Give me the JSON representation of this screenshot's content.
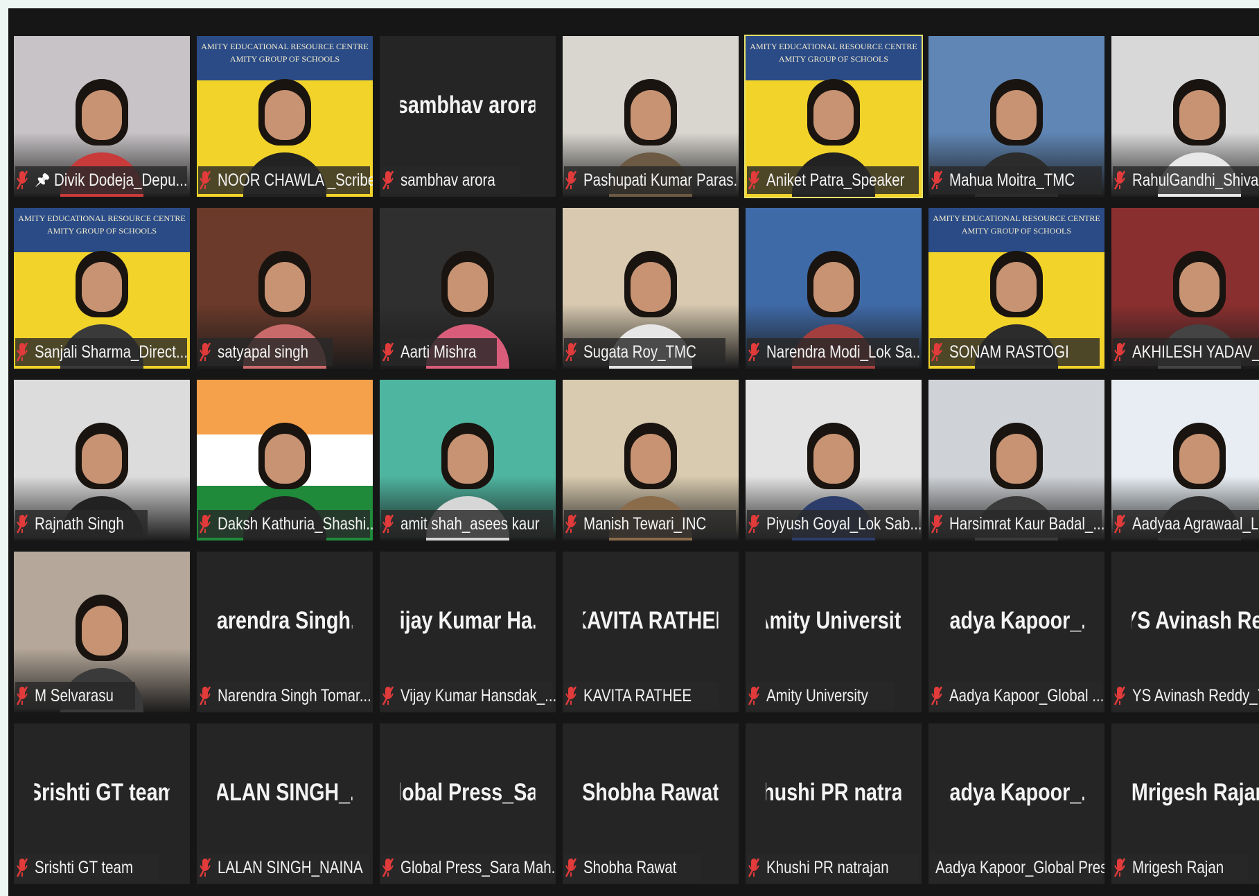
{
  "meeting": {
    "active_speaker": "Aniket Patra_Speaker",
    "colors": {
      "background": "#161616",
      "tile": "#252525",
      "active_border": "#e6e06a",
      "muted_icon": "#e23b3b"
    },
    "banner_text": "AMITY EDUCATIONAL RESOURCE CENTRE",
    "banner_sub": "AMITY GROUP OF SCHOOLS"
  },
  "rows": [
    [
      {
        "label": "Divik Dodeja_Depu...",
        "type": "video",
        "bg": "#c7c3c6",
        "shirt": "#c93a3a",
        "pinned": true
      },
      {
        "label": "NOOR CHAWLA _Scribe",
        "type": "banner",
        "shirt": "#222222"
      },
      {
        "label": "sambhav arora",
        "type": "name",
        "display": "sambhav arora"
      },
      {
        "label": "Pashupati Kumar Paras...",
        "type": "video",
        "bg": "#d9d6cf",
        "shirt": "#6c5a44"
      },
      {
        "label": "Aniket Patra_Speaker",
        "type": "banner",
        "shirt": "#222222",
        "active": true
      },
      {
        "label": "Mahua Moitra_TMC",
        "type": "video",
        "bg": "#5f86b5",
        "shirt": "#2c2c2c"
      },
      {
        "label": "RahulGandhi_Shivar",
        "type": "video",
        "bg": "#d8d8d8",
        "shirt": "#e8e8e8"
      }
    ],
    [
      {
        "label": "Sanjali Sharma_Direct...",
        "type": "banner",
        "shirt": "#3a3a3a"
      },
      {
        "label": "satyapal singh",
        "type": "video",
        "bg": "#6b3a2a",
        "shirt": "#c86a6a"
      },
      {
        "label": "Aarti Mishra",
        "type": "video",
        "bg": "#2f2f2f",
        "shirt": "#d95d7a"
      },
      {
        "label": "Sugata Roy_TMC",
        "type": "video",
        "bg": "#d8c9b0",
        "shirt": "#e6e6e6"
      },
      {
        "label": "Narendra Modi_Lok Sa...",
        "type": "video",
        "bg": "#3f6aa8",
        "shirt": "#a33f3f"
      },
      {
        "label": "SONAM RASTOGI",
        "type": "banner",
        "shirt": "#2c2c2c"
      },
      {
        "label": "AKHILESH YADAV_S",
        "type": "video",
        "bg": "#8a2f2f",
        "shirt": "#444444"
      }
    ],
    [
      {
        "label": "Rajnath Singh",
        "type": "video",
        "bg": "#dcdcdc",
        "shirt": "#222222"
      },
      {
        "label": "Daksh Kathuria_Shashi...",
        "type": "flag",
        "shirt": "#222222"
      },
      {
        "label": "amit shah_asees kaur",
        "type": "video",
        "bg": "#4eb5a0",
        "shirt": "#d6d6d6"
      },
      {
        "label": "Manish Tewari_INC",
        "type": "video",
        "bg": "#d9cbb0",
        "shirt": "#8a6b4a"
      },
      {
        "label": "Piyush Goyal_Lok Sab...",
        "type": "video",
        "bg": "#e3e3e3",
        "shirt": "#2c3d6b"
      },
      {
        "label": "Harsimrat Kaur Badal_...",
        "type": "video",
        "bg": "#cfd2d6",
        "shirt": "#3a3a3a"
      },
      {
        "label": "Aadyaa Agrawaal_Lo",
        "type": "video",
        "bg": "#e7edf2",
        "shirt": "#2e2e2e"
      }
    ],
    [
      {
        "label": "M Selvarasu",
        "type": "video",
        "bg": "#b5a89a",
        "shirt": "#3a3a3a"
      },
      {
        "label": "Narendra Singh Tomar...",
        "type": "name",
        "display": "Narendra Singh..."
      },
      {
        "label": "Vijay Kumar Hansdak_...",
        "type": "name",
        "display": "Vijay Kumar Ha..."
      },
      {
        "label": "KAVITA RATHEE",
        "type": "name",
        "display": "KAVITA RATHEE"
      },
      {
        "label": "Amity University",
        "type": "name",
        "display": "Amity University"
      },
      {
        "label": "Aadya Kapoor_Global ...",
        "type": "name",
        "display": "Aadya Kapoor_..."
      },
      {
        "label": "YS Avinash Reddy_Y",
        "type": "name",
        "display": "YS Avinash Red"
      }
    ],
    [
      {
        "label": "Srishti GT team",
        "type": "name",
        "display": "Srishti GT team"
      },
      {
        "label": "LALAN SINGH_NAINA",
        "type": "name",
        "display": "LALAN SINGH_..."
      },
      {
        "label": "Global Press_Sara Mah...",
        "type": "name",
        "display": "Global Press_Sa..."
      },
      {
        "label": "Shobha Rawat",
        "type": "name",
        "display": "Shobha Rawat"
      },
      {
        "label": "Khushi PR natrajan",
        "type": "name",
        "display": "Khushi PR natra..."
      },
      {
        "label": "Aadya Kapoor_Global Press",
        "type": "name",
        "display": "Aadya Kapoor_...",
        "unmuted": true
      },
      {
        "label": "Mrigesh Rajan",
        "type": "name",
        "display": "Mrigesh Rajan"
      }
    ]
  ]
}
